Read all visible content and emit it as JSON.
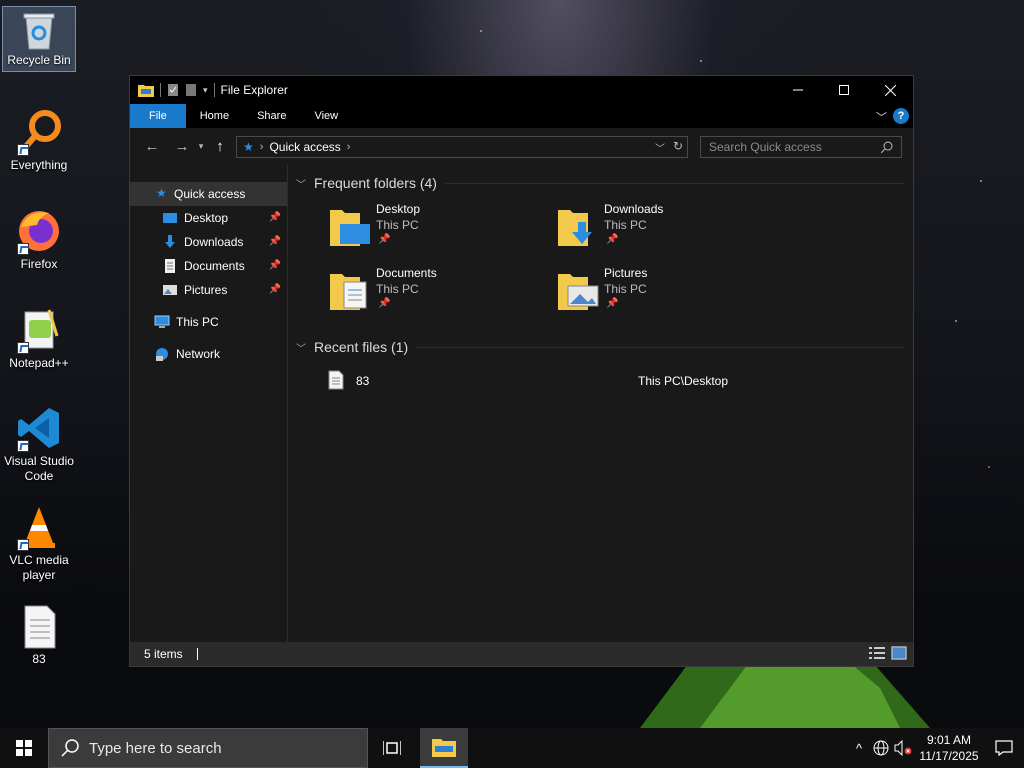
{
  "desktop": {
    "icons": [
      {
        "label": "Recycle Bin"
      },
      {
        "label": "Everything"
      },
      {
        "label": "Firefox"
      },
      {
        "label": "Notepad++"
      },
      {
        "label": "Visual Studio Code"
      },
      {
        "label": "VLC media player"
      },
      {
        "label": "83"
      }
    ]
  },
  "explorer": {
    "title": "File Explorer",
    "ribbon_tabs": [
      "File",
      "Home",
      "Share",
      "View"
    ],
    "address": {
      "location": "Quick access"
    },
    "search_placeholder": "Search Quick access",
    "nav": {
      "quick_access": "Quick access",
      "pinned": [
        "Desktop",
        "Downloads",
        "Documents",
        "Pictures"
      ],
      "this_pc": "This PC",
      "network": "Network"
    },
    "frequent": {
      "header": "Frequent folders (4)",
      "folders": [
        {
          "name": "Desktop",
          "location": "This PC"
        },
        {
          "name": "Downloads",
          "location": "This PC"
        },
        {
          "name": "Documents",
          "location": "This PC"
        },
        {
          "name": "Pictures",
          "location": "This PC"
        }
      ]
    },
    "recent": {
      "header": "Recent files (1)",
      "files": [
        {
          "name": "83",
          "path": "This PC\\Desktop"
        }
      ]
    },
    "status": {
      "items": "5 items"
    }
  },
  "taskbar": {
    "search_placeholder": "Type here to search",
    "time": "9:01 AM",
    "date": "11/17/2025"
  },
  "colors": {
    "accent": "#1979ca",
    "window_bg": "#191919",
    "taskbar_bg": "#101010"
  }
}
